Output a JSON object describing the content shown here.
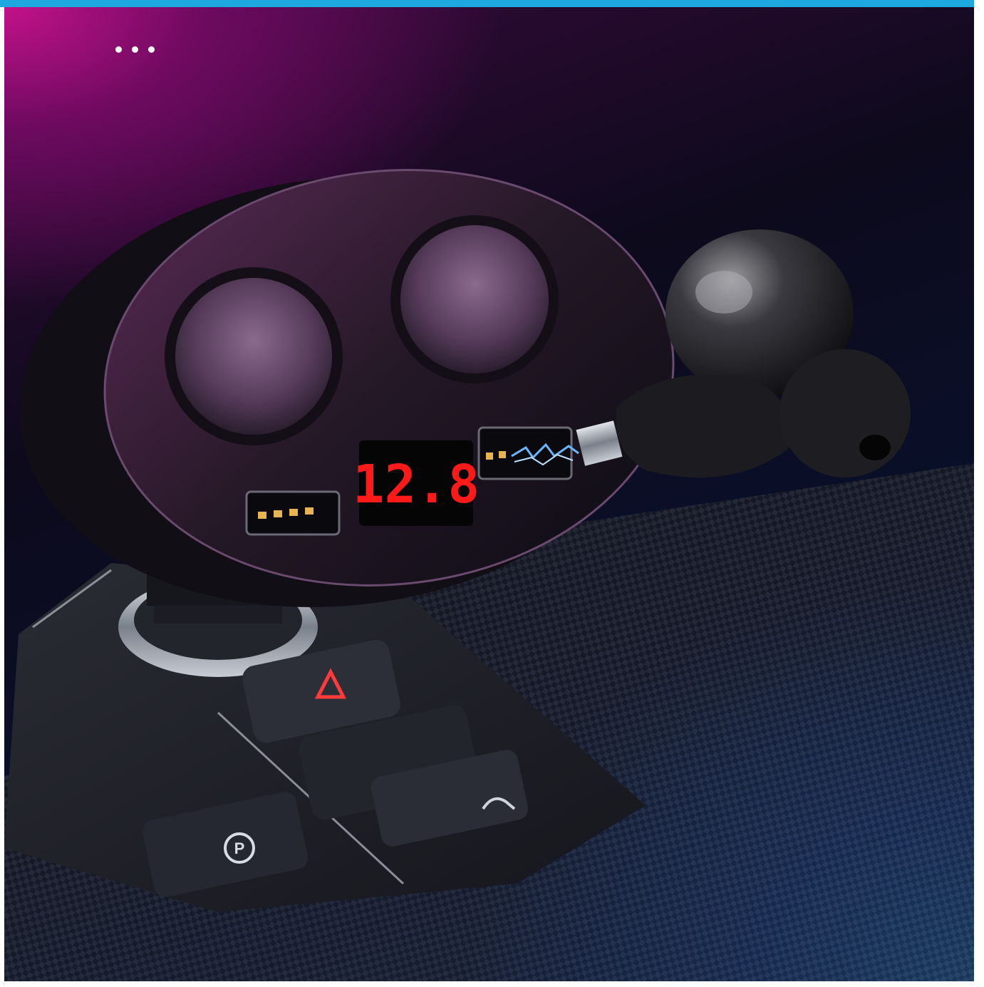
{
  "menu": {
    "icon": "more-dots-icon"
  },
  "device": {
    "voltage_display": "12.8",
    "display_color": "#ff1a1a"
  },
  "console": {
    "hazard_icon": "hazard-triangle-icon",
    "parking_icon": "parking-brake-icon",
    "parking_label": "P",
    "hill_icon": "hill-descent-icon"
  },
  "colors": {
    "accent_top": "#1ea8e0",
    "magenta": "#c2128a",
    "blue": "#1a8cff"
  }
}
